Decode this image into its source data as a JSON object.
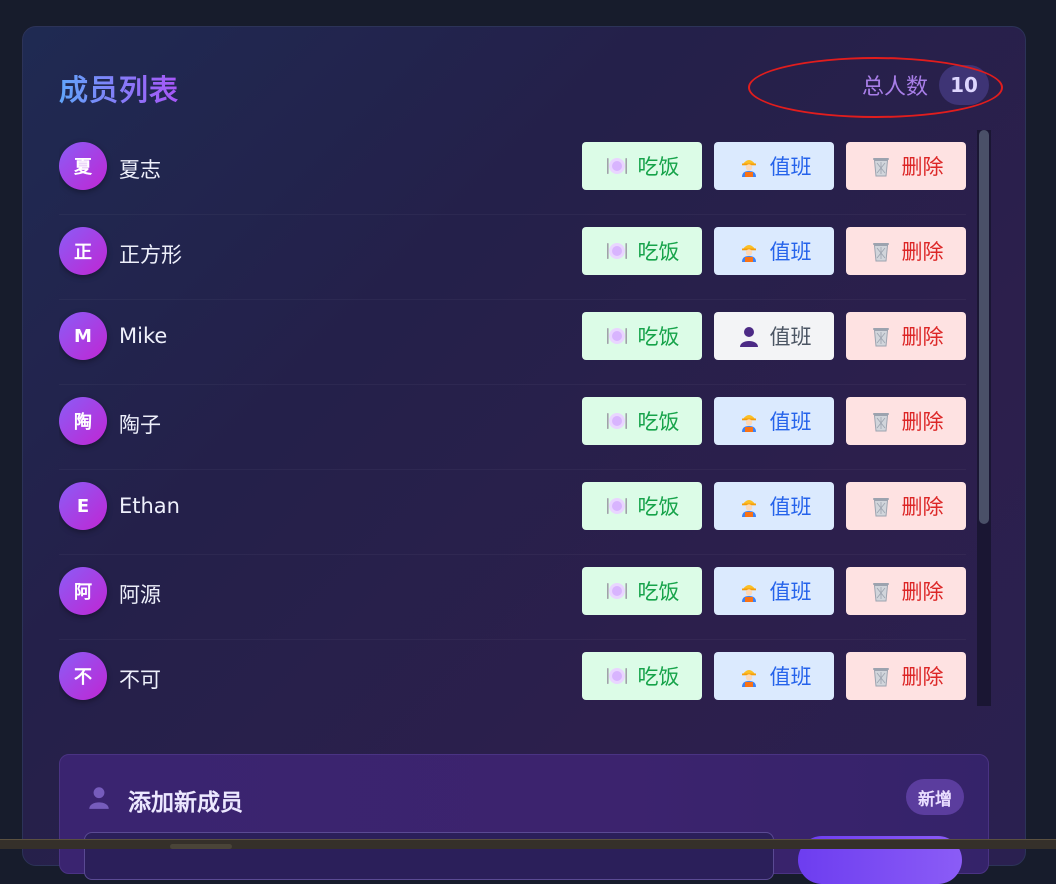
{
  "header": {
    "title": "成员列表",
    "total_label": "总人数",
    "total_count": "10"
  },
  "buttons": {
    "eat": "吃饭",
    "duty": "值班",
    "delete": "删除"
  },
  "members": [
    {
      "avatar": "夏",
      "name": "夏志",
      "duty_active": true
    },
    {
      "avatar": "正",
      "name": "正方形",
      "duty_active": true
    },
    {
      "avatar": "M",
      "name": "Mike",
      "duty_active": false
    },
    {
      "avatar": "陶",
      "name": "陶子",
      "duty_active": true
    },
    {
      "avatar": "E",
      "name": "Ethan",
      "duty_active": true
    },
    {
      "avatar": "阿",
      "name": "阿源",
      "duty_active": true
    },
    {
      "avatar": "不",
      "name": "不可",
      "duty_active": true
    }
  ],
  "add_member": {
    "title": "添加新成员",
    "badge": "新增"
  },
  "icons": {
    "eat": "fork-and-knife-with-plate-icon",
    "duty_active": "construction-worker-icon",
    "duty_inactive": "person-silhouette-icon",
    "delete": "wastebasket-icon",
    "add_member": "person-silhouette-icon"
  },
  "colors": {
    "eat_bg": "#dcfce7",
    "eat_text": "#16a34a",
    "duty_bg": "#dbeafe",
    "duty_text": "#2563eb",
    "duty_off_bg": "#f3f4f6",
    "duty_off_text": "#4b5563",
    "delete_bg": "#fee2e2",
    "delete_text": "#dc2626",
    "highlight": "#e11d1d"
  }
}
